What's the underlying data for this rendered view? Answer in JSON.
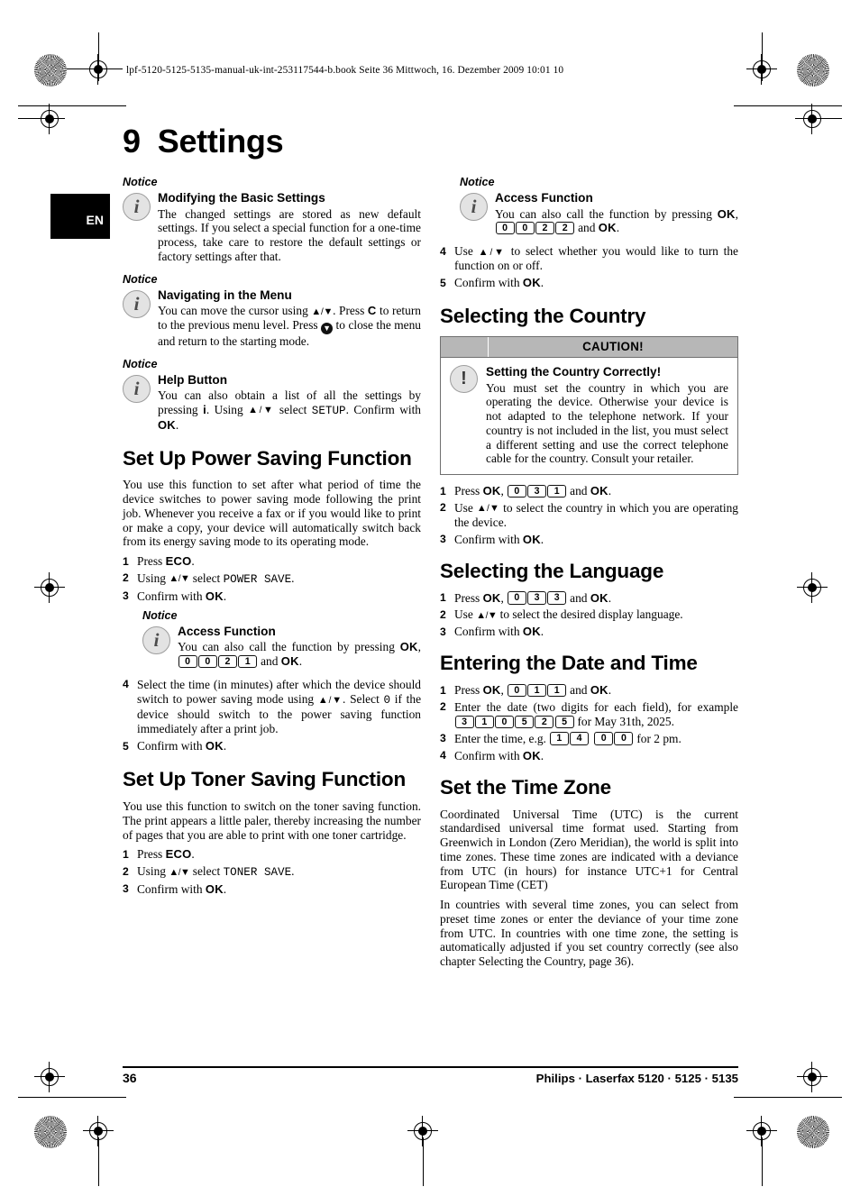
{
  "header": {
    "book_info": "lpf-5120-5125-5135-manual-uk-int-253117544-b.book  Seite 36  Mittwoch, 16. Dezember 2009  10:01 10"
  },
  "language_tab": "EN",
  "chapter": {
    "number": "9",
    "title": "Settings"
  },
  "notice_label": "Notice",
  "caution_label": "CAUTION!",
  "left_column": {
    "notice_basic": {
      "title": "Modifying the Basic Settings",
      "text": "The changed settings are stored as new default settings. If you select a special function for a one-time process, take care to restore the default settings or factory settings after that."
    },
    "notice_nav": {
      "title": "Navigating in the Menu",
      "text_1": "You can move the cursor using ",
      "text_2": ". Press ",
      "key_c": "C",
      "text_3": " to return to the previous menu level. Press ",
      "text_4": " to close the menu and return to the starting mode."
    },
    "notice_help": {
      "title": "Help Button",
      "text_1": "You can also obtain a list of all the settings by pressing ",
      "key_i": "i",
      "text_2": ". Using ",
      "text_3": " select ",
      "menu_item": "SETUP",
      "text_4": ". Confirm with ",
      "key_ok": "OK",
      "text_5": "."
    },
    "power_saving": {
      "heading": "Set Up Power Saving Function",
      "intro": "You use this function to set after what period of time the device switches to power saving mode following the print job. Whenever you receive a fax or if you would like to print or make a copy, your device will automatically switch back from its energy saving mode to its operating mode.",
      "step1_pre": "Press ",
      "step1_key": "ECO",
      "step1_post": ".",
      "step2_pre": "Using ",
      "step2_mid": " select ",
      "step2_menu": "POWER SAVE",
      "step2_post": ".",
      "step3_pre": "Confirm with ",
      "step3_key": "OK",
      "step3_post": ".",
      "notice_access": {
        "title": "Access Function",
        "text_1": "You can also call the function by pressing ",
        "key_ok": "OK",
        "comma": ", ",
        "keys": [
          "0",
          "0",
          "2",
          "1"
        ],
        "text_2": " and ",
        "key_ok2": "OK",
        "text_3": "."
      },
      "step4_a": "Select the time (in minutes) after which the device should switch to power saving mode using ",
      "step4_b": ". Select ",
      "step4_zero": "0",
      "step4_c": " if the device should switch to the power saving function immediately after a print job.",
      "step5_pre": "Confirm with ",
      "step5_key": "OK",
      "step5_post": "."
    },
    "toner_saving": {
      "heading": "Set Up Toner Saving Function",
      "intro": "You use this function to switch on the toner saving function. The print appears a little paler, thereby increasing the number of pages that you are able to print with one toner cartridge.",
      "step1_pre": "Press ",
      "step1_key": "ECO",
      "step1_post": ".",
      "step2_pre": "Using ",
      "step2_mid": " select ",
      "step2_menu": "TONER SAVE",
      "step2_post": ".",
      "step3_pre": "Confirm with ",
      "step3_key": "OK",
      "step3_post": "."
    }
  },
  "right_column": {
    "notice_access": {
      "title": "Access Function",
      "text_1": "You can also call the function by pressing ",
      "key_ok": "OK",
      "comma": ", ",
      "keys": [
        "0",
        "0",
        "2",
        "2"
      ],
      "text_2": " and ",
      "key_ok2": "OK",
      "text_3": "."
    },
    "step4_pre": "Use ",
    "step4_post": " to select whether you would like to turn the function on or off.",
    "step5_pre": "Confirm with ",
    "step5_key": "OK",
    "step5_post": ".",
    "selecting_country": {
      "heading": "Selecting the Country",
      "caution": {
        "title": "Setting the Country Correctly!",
        "text": "You must set the country in which you are operating the device. Otherwise your device is not adapted to the telephone network. If your country is not included in the list, you must select a different setting and use the correct telephone cable for the country. Consult your retailer."
      },
      "step1_pre": "Press ",
      "step1_ok": "OK",
      "step1_comma": ", ",
      "step1_keys": [
        "0",
        "3",
        "1"
      ],
      "step1_and": " and ",
      "step1_ok2": "OK",
      "step1_post": ".",
      "step2_pre": "Use ",
      "step2_post": " to select the country in which you are operating the device.",
      "step3_pre": "Confirm with ",
      "step3_key": "OK",
      "step3_post": "."
    },
    "selecting_language": {
      "heading": "Selecting the Language",
      "step1_pre": "Press ",
      "step1_ok": "OK",
      "step1_comma": ", ",
      "step1_keys": [
        "0",
        "3",
        "3"
      ],
      "step1_and": " and ",
      "step1_ok2": "OK",
      "step1_post": ".",
      "step2_pre": "Use ",
      "step2_post": " to select the desired display language.",
      "step3_pre": "Confirm with ",
      "step3_key": "OK",
      "step3_post": "."
    },
    "date_time": {
      "heading": "Entering the Date and Time",
      "step1_pre": "Press ",
      "step1_ok": "OK",
      "step1_comma": ", ",
      "step1_keys": [
        "0",
        "1",
        "1"
      ],
      "step1_and": " and ",
      "step1_ok2": "OK",
      "step1_post": ".",
      "step2_pre": "Enter the date (two digits for each field), for example ",
      "step2_keys": [
        "3",
        "1",
        "0",
        "5",
        "2",
        "5"
      ],
      "step2_post": " for May 31th, 2025.",
      "step3_pre": "Enter the time, e.g. ",
      "step3_keys_a": [
        "1",
        "4"
      ],
      "step3_keys_b": [
        "0",
        "0"
      ],
      "step3_post": " for 2 pm.",
      "step4_pre": "Confirm with ",
      "step4_key": "OK",
      "step4_post": "."
    },
    "time_zone": {
      "heading": "Set the Time Zone",
      "para_1": "Coordinated Universal Time (UTC) is the current standardised universal time format used.  Starting from Greenwich in London (Zero Meridian), the world is split into time zones. These time zones are indicated with a deviance from UTC (in hours) for instance UTC+1 for Central European Time (CET)",
      "para_2": "In countries with several time zones, you can select from preset time zones or enter the deviance of your time zone from UTC. In countries with one time zone, the setting is automatically adjusted if you set country correctly (see also chapter Selecting the Country, page 36)."
    }
  },
  "footer": {
    "page_number": "36",
    "product_line": "Philips · Laserfax 5120 · 5125 · 5135"
  },
  "steps_numbers": [
    "1",
    "2",
    "3",
    "4",
    "5"
  ]
}
